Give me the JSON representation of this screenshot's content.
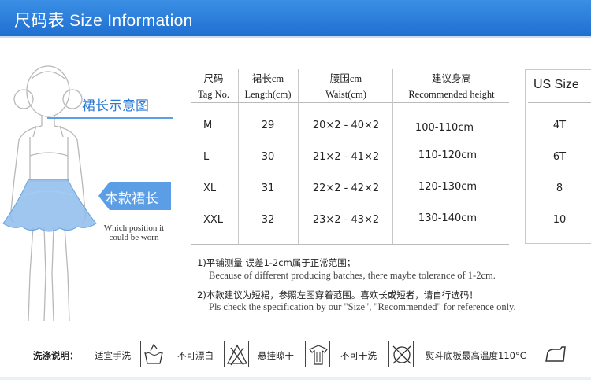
{
  "header": {
    "title": "尺码表 Size Information"
  },
  "figure": {
    "callout_length": "裙长示意图",
    "badge_text": "本款裙长",
    "which_position": "Which position it could be worn"
  },
  "table": {
    "headers": [
      {
        "cn": "尺码",
        "en": "Tag No."
      },
      {
        "cn": "裙长cm",
        "en": "Length(cm)"
      },
      {
        "cn": "腰围cm",
        "en": "Waist(cm)"
      },
      {
        "cn": "建议身高",
        "en": "Recommended height"
      }
    ],
    "rows": [
      {
        "tag": "M",
        "length": "29",
        "waist": "20×2 - 40×2",
        "height": "100-110cm"
      },
      {
        "tag": "L",
        "length": "30",
        "waist": "21×2 - 41×2",
        "height": "110-120cm"
      },
      {
        "tag": "XL",
        "length": "31",
        "waist": "22×2 - 42×2",
        "height": "120-130cm"
      },
      {
        "tag": "XXL",
        "length": "32",
        "waist": "23×2 - 43×2",
        "height": "130-140cm"
      }
    ],
    "us_title": "US Size",
    "us_sizes": [
      "4T",
      "6T",
      "8",
      "10"
    ]
  },
  "notes": [
    {
      "cn": "1)平铺测量 误差1-2cm属于正常范围；",
      "en": "Because of different producing batches, there maybe tolerance of 1-2cm."
    },
    {
      "cn": "2)本款建议为短裙，参照左图穿着范围。喜欢长或短者，请自行选码！",
      "en": "Pls check the specification by our \"Size\", \"Recommended\" for reference only."
    }
  ],
  "washing": {
    "label": "洗涤说明：",
    "items": [
      {
        "text": "适宜手洗",
        "icon": "hand-wash-icon"
      },
      {
        "text": "不可漂白",
        "icon": "no-bleach-icon"
      },
      {
        "text": "悬挂晾干",
        "icon": "hang-dry-icon"
      },
      {
        "text": "不可干洗",
        "icon": "no-dry-clean-icon"
      },
      {
        "text": "熨斗底板最高温度110°C",
        "icon": "iron-icon"
      }
    ]
  },
  "colors": {
    "header_blue": "#2a7fdc",
    "skirt_blue": "#6aa8e8",
    "accent": "#2b79d6"
  }
}
